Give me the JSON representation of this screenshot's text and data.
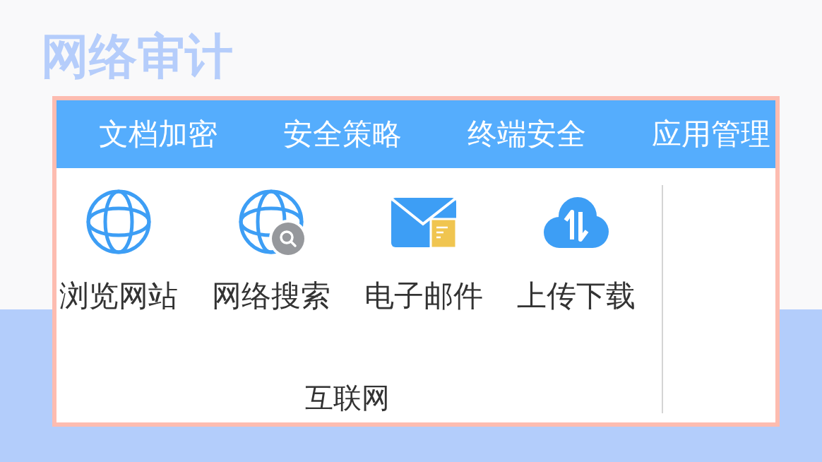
{
  "title": "网络审计",
  "tabs": [
    {
      "label": "文档加密"
    },
    {
      "label": "安全策略"
    },
    {
      "label": "终端安全"
    },
    {
      "label": "应用管理"
    }
  ],
  "ribbon_groups": [
    {
      "label": "互联网",
      "items": [
        {
          "label": "浏览网站",
          "kind": "web"
        },
        {
          "label": "网络搜索",
          "kind": "search"
        },
        {
          "label": "电子邮件",
          "kind": "email"
        },
        {
          "label": "上传下载",
          "kind": "transfer"
        }
      ]
    }
  ]
}
